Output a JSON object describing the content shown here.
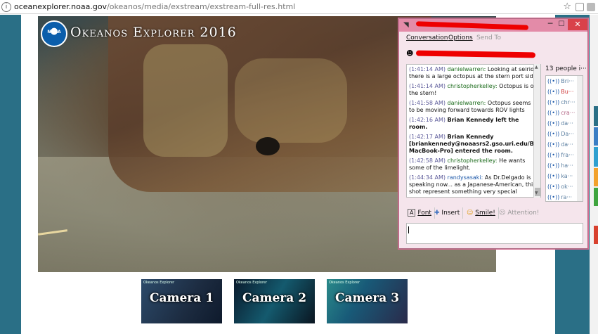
{
  "browser": {
    "url_domain": "oceanexplorer.noaa.gov",
    "url_path": "/okeanos/media/exstream/exstream-full-res.html"
  },
  "video": {
    "logo_text": "NOAA",
    "title": "Okeanos Explorer 2016"
  },
  "cameras": [
    {
      "label": "Camera 1",
      "logo": "Okeanos Explorer"
    },
    {
      "label": "Camera 2",
      "logo": "Okeanos Explorer"
    },
    {
      "label": "Camera 3",
      "logo": "Okeanos Explorer"
    }
  ],
  "chat": {
    "menu": {
      "conversation": "Conversation",
      "options": "Options",
      "send_to": "Send To"
    },
    "messages": [
      {
        "time": "(1:41:14 AM)",
        "user": "danielwarren:",
        "text": " Looking at seirios there is a large octopus at the stern port side"
      },
      {
        "time": "(1:41:14 AM)",
        "user": "christopherkelley:",
        "text": " Octopus is on the stern!"
      },
      {
        "time": "(1:41:58 AM)",
        "user": "danielwarren:",
        "text": " Octopus seems to be moving forward towards ROV lights"
      },
      {
        "time": "(1:42:16 AM)",
        "user": "",
        "text": "Brian Kennedy left the room."
      },
      {
        "time": "(1:42:17 AM)",
        "user": "",
        "text": "Brian Kennedy [briankennedy@noaasrs2.gso.uri.edu/Brians-MacBook-Pro] entered the room."
      },
      {
        "time": "(1:42:58 AM)",
        "user": "christopherkelley:",
        "text": " He wants some of the limelight."
      },
      {
        "time": "(1:44:34 AM)",
        "user": "randysasaki:",
        "text": " As Dr.Delgado is speaking now... as a Japanese-American, this shot represent something very special"
      }
    ],
    "people_count": "13 people i···",
    "people": [
      "Bri···",
      "Bu···",
      "chr···",
      "cra···",
      "da···",
      "Da···",
      "da···",
      "fra···",
      "ha···",
      "ka···",
      "ok···",
      "ra···"
    ],
    "toolbar": {
      "font": "Font",
      "insert": "Insert",
      "smile": "Smile!",
      "attention": "Attention!"
    }
  }
}
